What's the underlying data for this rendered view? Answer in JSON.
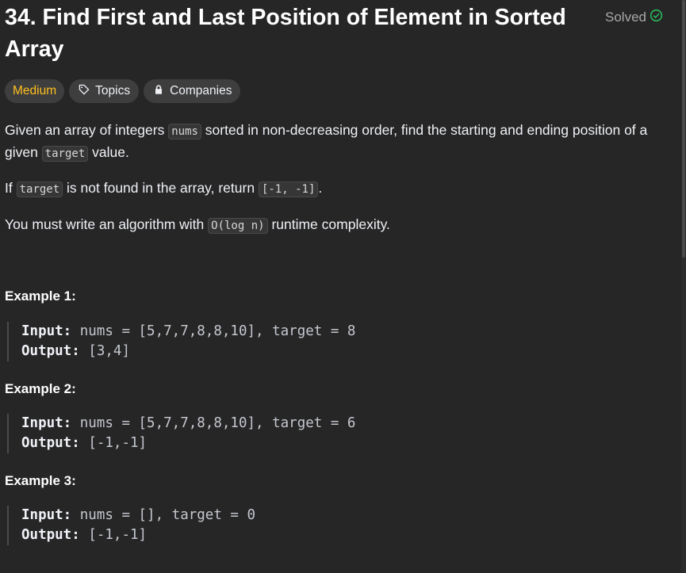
{
  "problem": {
    "title": "34. Find First and Last Position of Element in Sorted Array",
    "status": "Solved"
  },
  "tags": {
    "difficulty": "Medium",
    "topics": "Topics",
    "companies": "Companies"
  },
  "description": {
    "p1_before": "Given an array of integers ",
    "p1_code1": "nums",
    "p1_mid": " sorted in non-decreasing order, find the starting and ending position of a given ",
    "p1_code2": "target",
    "p1_after": " value.",
    "p2_before": "If ",
    "p2_code1": "target",
    "p2_mid": " is not found in the array, return ",
    "p2_code2": "[-1, -1]",
    "p2_after": ".",
    "p3_before": "You must write an algorithm with ",
    "p3_code": "O(log n)",
    "p3_after": " runtime complexity."
  },
  "examples": [
    {
      "title": "Example 1:",
      "input_label": "Input:",
      "input": "nums = [5,7,7,8,8,10], target = 8",
      "output_label": "Output:",
      "output": "[3,4]"
    },
    {
      "title": "Example 2:",
      "input_label": "Input:",
      "input": "nums = [5,7,7,8,8,10], target = 6",
      "output_label": "Output:",
      "output": "[-1,-1]"
    },
    {
      "title": "Example 3:",
      "input_label": "Input:",
      "input": "nums = [], target = 0",
      "output_label": "Output:",
      "output": "[-1,-1]"
    }
  ],
  "colors": {
    "background": "#262626",
    "difficulty_medium": "#ffc01e",
    "solved_check": "#2cbb5d"
  }
}
